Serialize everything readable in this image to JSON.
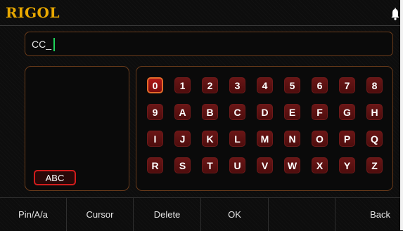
{
  "header": {
    "logo": "RIGOL",
    "icon": "bell-icon"
  },
  "input": {
    "value": "CC_"
  },
  "candidates": {
    "mode_label": "ABC"
  },
  "keyboard": {
    "keys": [
      "0",
      "1",
      "2",
      "3",
      "4",
      "5",
      "6",
      "7",
      "8",
      "9",
      "A",
      "B",
      "C",
      "D",
      "E",
      "F",
      "G",
      "H",
      "I",
      "J",
      "K",
      "L",
      "M",
      "N",
      "O",
      "P",
      "Q",
      "R",
      "S",
      "T",
      "U",
      "V",
      "W",
      "X",
      "Y",
      "Z"
    ],
    "selected": "0"
  },
  "softkeys": [
    "Pin/A/a",
    "Cursor",
    "Delete",
    "OK",
    "",
    "Back"
  ],
  "colors": {
    "accent": "#e8a800",
    "key": "#5c1010",
    "key_selected": "#b01818",
    "border": "#6a3b1a",
    "caret": "#1ed35a"
  }
}
